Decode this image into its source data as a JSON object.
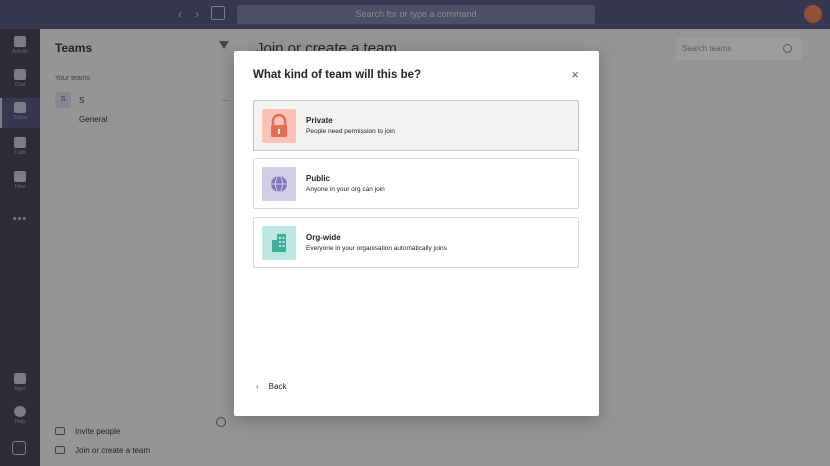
{
  "topbar": {
    "search_placeholder": "Search for or type a command"
  },
  "rail": {
    "items": [
      {
        "label": "Activity"
      },
      {
        "label": "Chat"
      },
      {
        "label": "Teams"
      },
      {
        "label": "Calls"
      },
      {
        "label": "Files"
      }
    ],
    "more": "•••",
    "bottom_items": [
      {
        "label": "Apps"
      },
      {
        "label": "Help"
      }
    ]
  },
  "panel": {
    "title": "Teams",
    "section_label": "Your teams",
    "team": {
      "avatar": "S",
      "name": "S",
      "more": "..."
    },
    "channel": "General",
    "invite_label": "Invite people",
    "join_label": "Join or create a team"
  },
  "main": {
    "title": "Join or create a team",
    "search_placeholder": "Search teams"
  },
  "modal": {
    "title": "What kind of team will this be?",
    "close": "×",
    "options": [
      {
        "title": "Private",
        "description": "People need permission to join",
        "icon": "lock-icon",
        "icon_bg": "#f8c2b6",
        "icon_fg": "#e46d53"
      },
      {
        "title": "Public",
        "description": "Anyone in your org can join",
        "icon": "globe-icon",
        "icon_bg": "#d3cde7",
        "icon_fg": "#8176b8"
      },
      {
        "title": "Org-wide",
        "description": "Everyone in your organisation automatically joins",
        "icon": "building-icon",
        "icon_bg": "#bde8e1",
        "icon_fg": "#3fae9a"
      }
    ],
    "back": "Back"
  },
  "colors": {
    "topbar": "#464775",
    "rail": "#33344a",
    "accent": "#6264a7"
  }
}
